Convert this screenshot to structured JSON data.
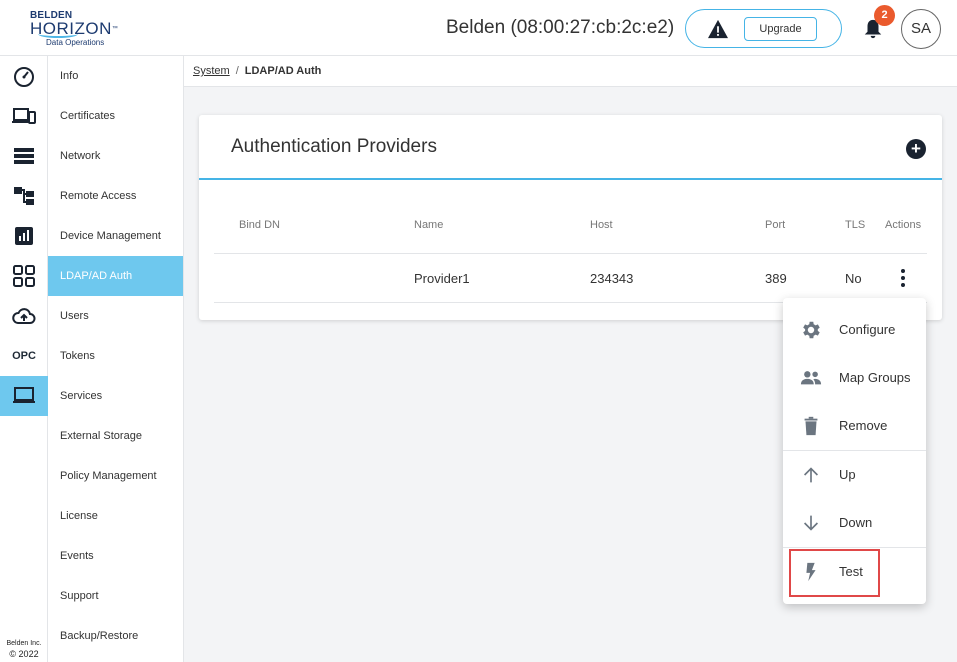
{
  "header": {
    "logo": {
      "line1": "BELDEN",
      "line2": "HORIZON",
      "tm": "™",
      "line3": "Data Operations"
    },
    "device_title": "Belden (08:00:27:cb:2c:e2)",
    "upgrade_label": "Upgrade",
    "notification_count": "2",
    "avatar_initials": "SA"
  },
  "rail": {
    "items": [
      {
        "icon": "dashboard-gauge-icon"
      },
      {
        "icon": "devices-icon"
      },
      {
        "icon": "list-icon"
      },
      {
        "icon": "topology-icon"
      },
      {
        "icon": "analytics-chart-icon"
      },
      {
        "icon": "apps-grid-icon"
      },
      {
        "icon": "cloud-upload-icon"
      },
      {
        "icon": "opc-icon",
        "text": "OPC"
      },
      {
        "icon": "laptop-icon",
        "active": true
      }
    ],
    "copyright_line1": "Belden Inc.",
    "copyright_line2": "© 2022"
  },
  "subnav": {
    "items": [
      "Info",
      "Certificates",
      "Network",
      "Remote Access",
      "Device Management",
      "LDAP/AD Auth",
      "Users",
      "Tokens",
      "Services",
      "External Storage",
      "Policy Management",
      "License",
      "Events",
      "Support",
      "Backup/Restore"
    ],
    "active": "LDAP/AD Auth"
  },
  "breadcrumb": {
    "parent": "System",
    "separator": "/",
    "current": "LDAP/AD Auth"
  },
  "card": {
    "title": "Authentication Providers",
    "add_label": "+",
    "columns": [
      "Bind DN",
      "Name",
      "Host",
      "Port",
      "TLS",
      "Actions"
    ],
    "rows": [
      {
        "bind_dn": "",
        "name": "Provider1",
        "host": "234343",
        "port": "389",
        "tls": "No"
      }
    ]
  },
  "menu": {
    "items": [
      {
        "label": "Configure",
        "icon": "gear-icon"
      },
      {
        "label": "Map Groups",
        "icon": "people-icon"
      },
      {
        "label": "Remove",
        "icon": "trash-icon"
      },
      {
        "label": "Up",
        "icon": "arrow-up-icon"
      },
      {
        "label": "Down",
        "icon": "arrow-down-icon"
      },
      {
        "label": "Test",
        "icon": "lightning-icon"
      }
    ]
  },
  "colors": {
    "accent": "#45b4e6",
    "active_nav": "#6ec8ee",
    "badge": "#ea5a2d",
    "highlight": "#e04848",
    "dark_icon": "#1a2330"
  }
}
